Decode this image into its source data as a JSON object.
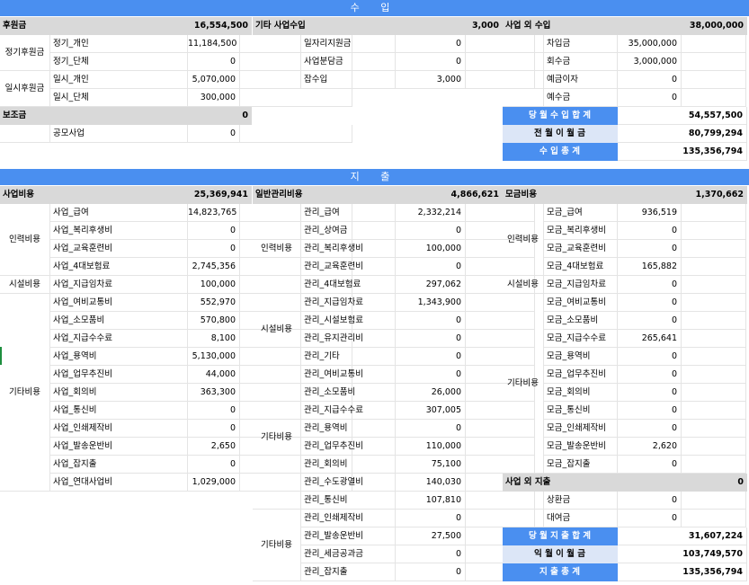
{
  "income_title": "수 입",
  "expense_title": "지 출",
  "income": {
    "sponsorship": {
      "title": "후원금",
      "total": "16,554,500",
      "groups": [
        {
          "label": "정기후원금",
          "rows": [
            {
              "name": "정기_개인",
              "value": "11,184,500"
            },
            {
              "name": "정기_단체",
              "value": "0"
            }
          ]
        },
        {
          "label": "일시후원금",
          "rows": [
            {
              "name": "일시_개인",
              "value": "5,070,000"
            },
            {
              "name": "일시_단체",
              "value": "300,000"
            }
          ]
        }
      ]
    },
    "subsidy": {
      "title": "보조금",
      "total": "0",
      "rows": [
        {
          "name": "공모사업",
          "value": "0"
        }
      ]
    },
    "other_business": {
      "title": "기타 사업수입",
      "total": "3,000",
      "rows": [
        {
          "name": "일자리지원금",
          "value": "0"
        },
        {
          "name": "사업분담금",
          "value": "0"
        },
        {
          "name": "잡수입",
          "value": "3,000"
        }
      ]
    },
    "non_business": {
      "title": "사업 외 수입",
      "total": "38,000,000",
      "rows": [
        {
          "name": "차입금",
          "value": "35,000,000"
        },
        {
          "name": "회수금",
          "value": "3,000,000"
        },
        {
          "name": "예금이자",
          "value": "0"
        },
        {
          "name": "예수금",
          "value": "0"
        }
      ]
    },
    "summary": [
      {
        "label": "당 월 수 입 합 계",
        "value": "54,557,500"
      },
      {
        "label": "전 월 이 월 금",
        "value": "80,799,294"
      },
      {
        "label": "수 입 총 계",
        "value": "135,356,794"
      }
    ]
  },
  "expense": {
    "business": {
      "title": "사업비용",
      "total": "25,369,941",
      "groups": [
        {
          "label": "인력비용",
          "rows": [
            {
              "name": "사업_급여",
              "value": "14,823,765"
            },
            {
              "name": "사업_복리후생비",
              "value": "0"
            },
            {
              "name": "사업_교육훈련비",
              "value": "0"
            },
            {
              "name": "사업_4대보험료",
              "value": "2,745,356"
            }
          ]
        },
        {
          "label": "시설비용",
          "rows": [
            {
              "name": "사업_지급임차료",
              "value": "100,000"
            }
          ]
        },
        {
          "label": "기타비용",
          "rows": [
            {
              "name": "사업_여비교통비",
              "value": "552,970"
            },
            {
              "name": "사업_소모품비",
              "value": "570,800"
            },
            {
              "name": "사업_지급수수료",
              "value": "8,100"
            },
            {
              "name": "사업_용역비",
              "value": "5,130,000"
            },
            {
              "name": "사업_업무추진비",
              "value": "44,000"
            },
            {
              "name": "사업_회의비",
              "value": "363,300"
            },
            {
              "name": "사업_통신비",
              "value": "0"
            },
            {
              "name": "사업_인쇄제작비",
              "value": "0"
            },
            {
              "name": "사업_발송운반비",
              "value": "2,650"
            },
            {
              "name": "사업_잡지출",
              "value": "0"
            },
            {
              "name": "사업_연대사업비",
              "value": "1,029,000"
            }
          ]
        }
      ]
    },
    "general_admin": {
      "title": "일반관리비용",
      "total": "4,866,621",
      "groups": [
        {
          "label": "인력비용",
          "rows": [
            {
              "name": "관리_급여",
              "value": "2,332,214"
            },
            {
              "name": "관리_상여금",
              "value": "0"
            },
            {
              "name": "관리_복리후생비",
              "value": "100,000"
            },
            {
              "name": "관리_교육훈련비",
              "value": "0"
            },
            {
              "name": "관리_4대보험료",
              "value": "297,062"
            }
          ]
        },
        {
          "label": "시설비용",
          "rows": [
            {
              "name": "관리_지급임차료",
              "value": "1,343,900"
            },
            {
              "name": "관리_시설보험료",
              "value": "0"
            },
            {
              "name": "관리_유지관리비",
              "value": "0"
            },
            {
              "name": "관리_기타",
              "value": "0"
            }
          ]
        },
        {
          "label": "기타비용",
          "rows": [
            {
              "name": "관리_여비교통비",
              "value": "0"
            },
            {
              "name": "관리_소모품비",
              "value": "26,000"
            },
            {
              "name": "관리_지급수수료",
              "value": "307,005"
            },
            {
              "name": "관리_용역비",
              "value": "0"
            },
            {
              "name": "관리_업무추진비",
              "value": "110,000"
            },
            {
              "name": "관리_회의비",
              "value": "75,100"
            },
            {
              "name": "관리_수도광열비",
              "value": "140,030"
            },
            {
              "name": "관리_통신비",
              "value": "107,810"
            }
          ]
        },
        {
          "label": "기타비용",
          "rows": [
            {
              "name": "관리_인쇄제작비",
              "value": "0"
            },
            {
              "name": "관리_발송운반비",
              "value": "27,500"
            },
            {
              "name": "관리_세금공과금",
              "value": "0"
            },
            {
              "name": "관리_잡지출",
              "value": "0"
            }
          ]
        }
      ]
    },
    "fundraising": {
      "title": "모금비용",
      "total": "1,370,662",
      "groups": [
        {
          "label": "인력비용",
          "rows": [
            {
              "name": "모금_급여",
              "value": "936,519"
            },
            {
              "name": "모금_복리후생비",
              "value": "0"
            },
            {
              "name": "모금_교육훈련비",
              "value": "0"
            },
            {
              "name": "모금_4대보험료",
              "value": "165,882"
            }
          ]
        },
        {
          "label": "시설비용",
          "rows": [
            {
              "name": "모금_지급임차료",
              "value": "0"
            }
          ]
        },
        {
          "label": "기타비용",
          "rows": [
            {
              "name": "모금_여비교통비",
              "value": "0"
            },
            {
              "name": "모금_소모품비",
              "value": "0"
            },
            {
              "name": "모금_지급수수료",
              "value": "265,641"
            },
            {
              "name": "모금_용역비",
              "value": "0"
            },
            {
              "name": "모금_업무추진비",
              "value": "0"
            },
            {
              "name": "모금_회의비",
              "value": "0"
            },
            {
              "name": "모금_통신비",
              "value": "0"
            },
            {
              "name": "모금_인쇄제작비",
              "value": "0"
            },
            {
              "name": "모금_발송운반비",
              "value": "2,620"
            },
            {
              "name": "모금_잡지출",
              "value": "0"
            }
          ]
        }
      ]
    },
    "non_business": {
      "title": "사업 외 지출",
      "total": "0",
      "rows": [
        {
          "name": "상환금",
          "value": "0"
        },
        {
          "name": "대여금",
          "value": "0"
        }
      ]
    },
    "summary": [
      {
        "label": "당 월 지 출 합 계",
        "value": "31,607,224"
      },
      {
        "label": "익 월 이 월 금",
        "value": "103,749,570"
      },
      {
        "label": "지 출 총 계",
        "value": "135,356,794"
      }
    ]
  },
  "colors": {
    "band": "#4a8ff0",
    "header_gray": "#d9d9d9",
    "summary_light": "#dce6f7"
  }
}
